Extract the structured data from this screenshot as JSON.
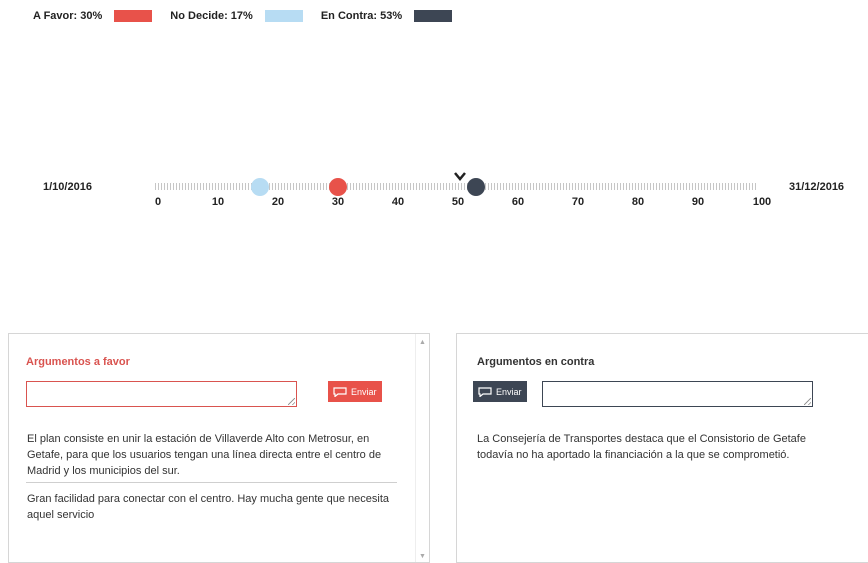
{
  "legend": [
    {
      "label": "A Favor: 30%",
      "color": "#e8524a"
    },
    {
      "label": "No Decide: 17%",
      "color": "#b7dcf3"
    },
    {
      "label": "En Contra: 53%",
      "color": "#3d4654"
    }
  ],
  "timeline": {
    "start_date": "1/10/2016",
    "end_date": "31/12/2016",
    "ticks": [
      "0",
      "10",
      "20",
      "30",
      "40",
      "50",
      "60",
      "70",
      "80",
      "90",
      "100"
    ],
    "markers": [
      {
        "name": "no-decide",
        "value": 17,
        "color": "#b7dcf3"
      },
      {
        "name": "a-favor",
        "value": 30,
        "color": "#e8524a"
      },
      {
        "name": "en-contra",
        "value": 53,
        "color": "#3d4654"
      }
    ]
  },
  "favor_panel": {
    "title": "Argumentos a favor",
    "send_label": "Enviar",
    "arguments": [
      "El plan consiste en unir la estación de Villaverde Alto con Metrosur, en Getafe, para que los usuarios tengan una línea directa entre el centro de Madrid y los municipios del sur.",
      "Gran facilidad para conectar con el centro. Hay mucha gente que necesita aquel servicio"
    ]
  },
  "contra_panel": {
    "title": "Argumentos en contra",
    "send_label": "Enviar",
    "arguments": [
      "La Consejería de Transportes destaca que el Consistorio de Getafe todavía no ha aportado la financiación a la que se comprometió."
    ]
  }
}
